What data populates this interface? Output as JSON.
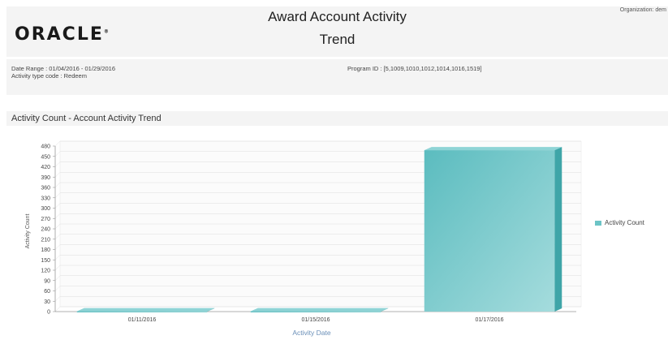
{
  "header": {
    "logo_text": "ORACLE",
    "title_line1": "Award Account Activity",
    "title_line2": "Trend",
    "organization": "Organization: dem"
  },
  "params": {
    "date_range": "Date Range : 01/04/2016 - 01/29/2016",
    "activity_type": "Activity type code : Redeem",
    "program_id": "Program ID : [5,1009,1010,1012,1014,1016,1519]"
  },
  "section_title": "Activity Count  - Account Activity Trend",
  "colors": {
    "bar": "#6cc4c6",
    "bar_dark": "#4fb0b3",
    "band": "#f4f4f4"
  },
  "chart_data": {
    "type": "bar",
    "categories": [
      "01/11/2016",
      "01/15/2016",
      "01/17/2016"
    ],
    "series": [
      {
        "name": "Activity Count",
        "values": [
          1,
          1,
          468
        ]
      }
    ],
    "ylabel": "Activity Count",
    "xlabel": "Activity Date",
    "ylim": [
      0,
      480
    ],
    "yticks": [
      0,
      30,
      60,
      90,
      120,
      150,
      180,
      210,
      240,
      270,
      300,
      330,
      360,
      390,
      420,
      450,
      480
    ],
    "grid": true,
    "legend": "right"
  }
}
